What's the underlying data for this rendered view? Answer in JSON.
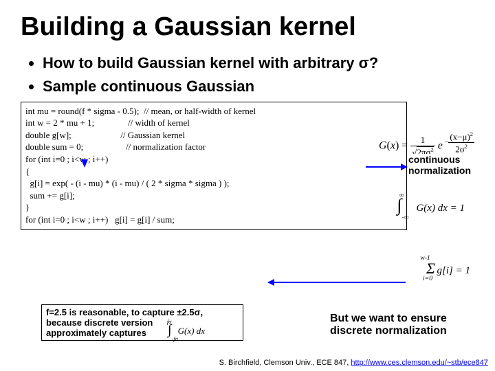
{
  "title": "Building a Gaussian kernel",
  "bullets": [
    "How to build Gaussian kernel with arbitrary σ?",
    "Sample continuous Gaussian"
  ],
  "code": "int mu = round(f * sigma - 0.5);  // mean, or half-width of kernel\nint w = 2 * mu + 1;               // width of kernel\ndouble g[w];                      // Gaussian kernel\ndouble sum = 0;                   // normalization factor\nfor (int i=0 ; i<w ; i++)\n{\n  g[i] = exp( - (i - mu) * (i - mu) / ( 2 * sigma * sigma ) );\n  sum += g[i];\n}\nfor (int i=0 ; i<w ; i++)   g[i] = g[i] / sum;",
  "labels": {
    "cont_norm": "continuous normalization",
    "f_note_l1": "f=2.5 is reasonable, to capture ±2.5σ,",
    "f_note_l2": "because discrete version",
    "f_note_l3": "approximately captures",
    "want_l1": "But we want to ensure",
    "want_l2": "discrete normalization"
  },
  "formulas": {
    "main": "G(x) = (1 / √(2πσ²)) e^{ -(x-μ)² / 2σ² }",
    "int": "∫_{-∞}^{∞} G(x) dx = 1",
    "sum": "Σ_{i=0}^{w-1} g[i] = 1",
    "int_small": "∫_{-fσ}^{fσ} G(x) dx"
  },
  "footer": {
    "text": "S. Birchfield, Clemson Univ., ECE 847, ",
    "link_text": "http://www.ces.clemson.edu/~stb/ece847",
    "link_href": "http://www.ces.clemson.edu/~stb/ece847"
  }
}
